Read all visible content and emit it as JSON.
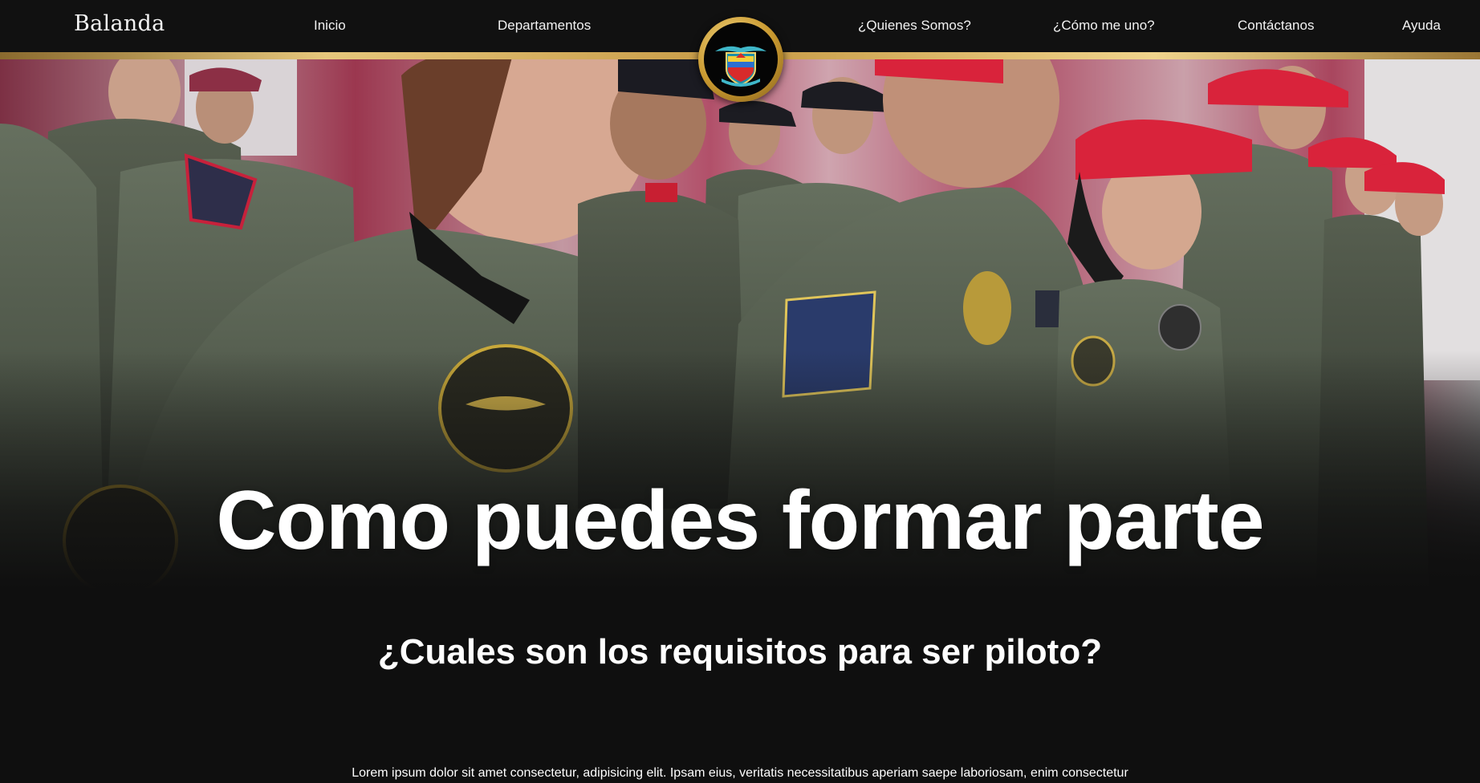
{
  "navbar": {
    "brand": "Balanda",
    "links": [
      "Inicio",
      "Departamentos",
      "¿Quienes Somos?",
      "¿Cómo me uno?",
      "Contáctanos",
      "Ayuda"
    ],
    "emblem_icon": "military-aviation-crest-icon"
  },
  "hero": {
    "image": "soldiers-in-flight-suits-formation-photo",
    "title": "Como puedes formar parte"
  },
  "section": {
    "subtitle": "¿Cuales son los requisitos para ser piloto?",
    "paragraph": "Lorem ipsum dolor sit amet consectetur, adipisicing elit. Ipsam eius, veritatis necessitatibus aperiam saepe laboriosam, enim consectetur"
  },
  "colors": {
    "background": "#0f0f0f",
    "navbar": "#111111",
    "gold_accent": "#d4ae5c",
    "text": "#ffffff"
  }
}
